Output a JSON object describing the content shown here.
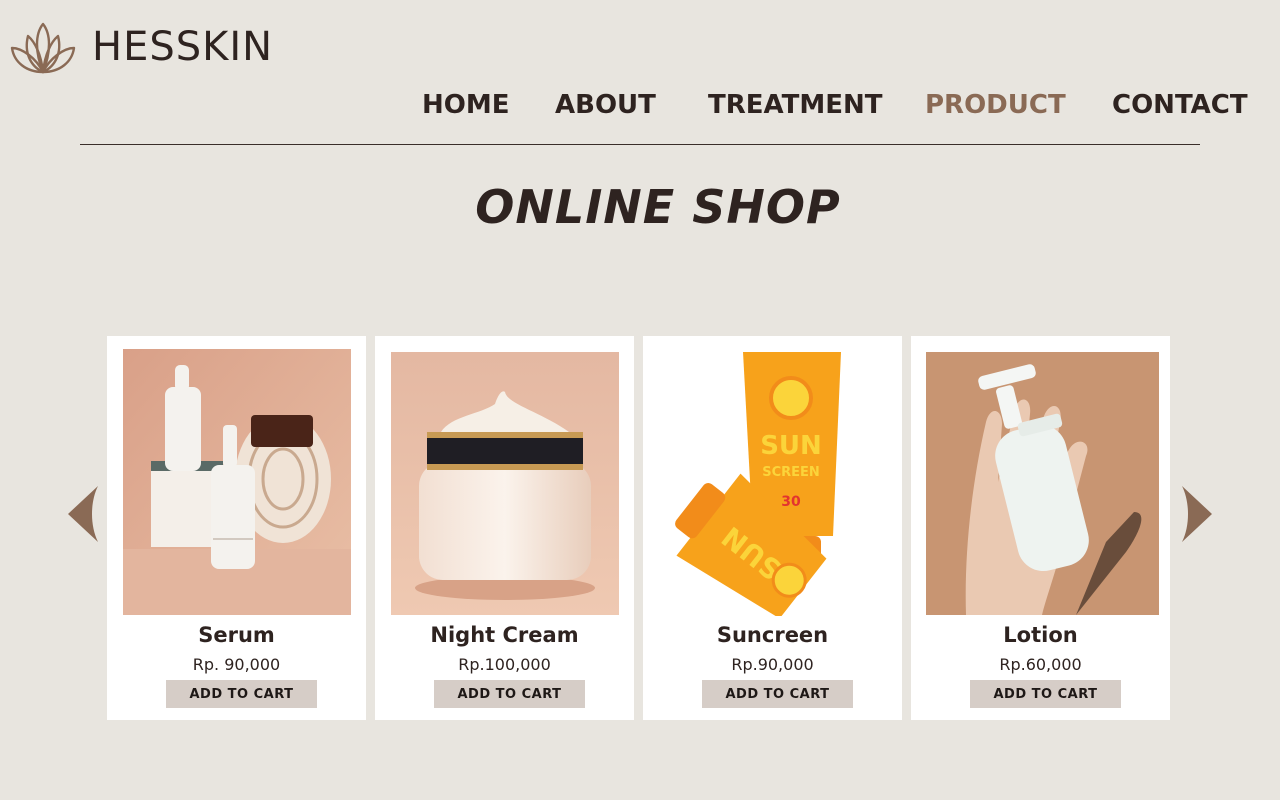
{
  "brand": {
    "name": "HESSKIN",
    "logo_icon": "lotus-icon",
    "accent_color": "#8a6a55"
  },
  "nav": {
    "items": [
      {
        "label": "HOME",
        "active": false
      },
      {
        "label": "ABOUT",
        "active": false
      },
      {
        "label": "TREATMENT",
        "active": false
      },
      {
        "label": "PRODUCT",
        "active": true
      },
      {
        "label": "CONTACT",
        "active": false
      }
    ]
  },
  "page": {
    "title": "ONLINE SHOP"
  },
  "carousel": {
    "prev_icon": "arrow-left-icon",
    "next_icon": "arrow-right-icon",
    "products": [
      {
        "name": "Serum",
        "price": "Rp. 90,000",
        "button_label": "ADD TO CART",
        "image": "serum-bottles-image"
      },
      {
        "name": "Night Cream",
        "price": "Rp.100,000",
        "button_label": "ADD TO CART",
        "image": "cream-jar-image"
      },
      {
        "name": "Suncreen",
        "price": "Rp.90,000",
        "button_label": "ADD TO CART",
        "image": "sunscreen-tubes-image"
      },
      {
        "name": "Lotion",
        "price": "Rp.60,000",
        "button_label": "ADD TO CART",
        "image": "lotion-bottle-image"
      }
    ]
  }
}
